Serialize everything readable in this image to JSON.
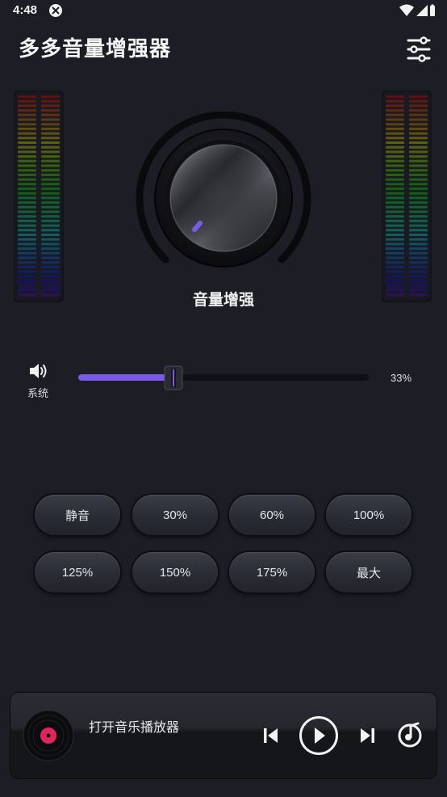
{
  "status_bar": {
    "time": "4:48"
  },
  "header": {
    "title": "多多音量增强器"
  },
  "knob": {
    "label": "音量增强"
  },
  "volume": {
    "source_label": "系统",
    "percent_label": "33%",
    "level": 0.33
  },
  "presets": [
    "静音",
    "30%",
    "60%",
    "100%",
    "125%",
    "150%",
    "175%",
    "最大"
  ],
  "player": {
    "title": "打开音乐播放器"
  },
  "colors": {
    "accent": "#7a5ae6",
    "background": "#1c1d25",
    "disc_center": "#e0245e"
  },
  "icons": {
    "settings": "sliders-icon",
    "speaker": "speaker-icon",
    "prev": "skip-previous-icon",
    "play": "play-circle-icon",
    "next": "skip-next-icon",
    "music": "music-note-icon"
  }
}
